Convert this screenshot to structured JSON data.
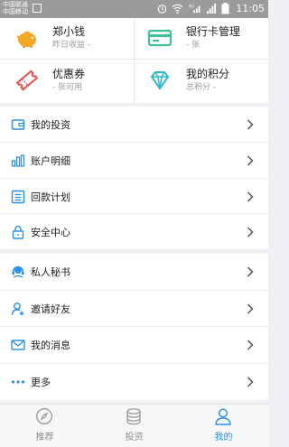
{
  "status_bar": {
    "carrier1": "中国联通",
    "carrier2": "中国移动",
    "network": "4G",
    "time": "11:05"
  },
  "cards": [
    {
      "title": "郑小钱",
      "subtitle": "昨日收益 -",
      "icon": "piggy-bank-icon"
    },
    {
      "title": "银行卡管理",
      "subtitle": "- 张",
      "icon": "bank-card-icon"
    },
    {
      "title": "优惠券",
      "subtitle": "- 张可用",
      "icon": "coupon-ticket-icon"
    },
    {
      "title": "我的积分",
      "subtitle": "总积分 -",
      "icon": "diamond-icon"
    }
  ],
  "menu": {
    "group1": [
      {
        "label": "我的投资",
        "icon": "wallet-icon"
      },
      {
        "label": "账户明细",
        "icon": "bar-chart-icon"
      },
      {
        "label": "回款计划",
        "icon": "list-icon"
      },
      {
        "label": "安全中心",
        "icon": "lock-icon"
      }
    ],
    "group2": [
      {
        "label": "私人秘书",
        "icon": "headset-icon"
      },
      {
        "label": "邀请好友",
        "icon": "invite-user-icon"
      },
      {
        "label": "我的消息",
        "icon": "mail-icon"
      },
      {
        "label": "更多",
        "icon": "more-dots-icon"
      }
    ]
  },
  "tabs": [
    {
      "label": "推荐",
      "icon": "compass-icon"
    },
    {
      "label": "投资",
      "icon": "coins-icon"
    },
    {
      "label": "我的",
      "icon": "person-icon"
    }
  ],
  "colors": {
    "accent": "#2a90e8",
    "piggy": "#f5a623",
    "card": "#3ec28f",
    "coupon": "#ee4b4b",
    "diamond": "#2fb7c8"
  }
}
